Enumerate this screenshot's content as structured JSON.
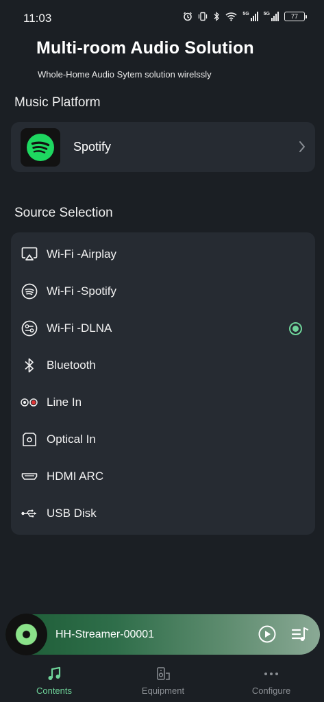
{
  "status_bar": {
    "time": "11:03",
    "signal1_label": "5G",
    "signal2_label": "5G",
    "battery": "77"
  },
  "header": {
    "title": "Multi-room Audio Solution",
    "subtitle": "Whole-Home Audio Sytem solution wirelssly"
  },
  "music_platform": {
    "section_title": "Music Platform",
    "items": [
      {
        "label": "Spotify",
        "icon": "spotify-logo-icon"
      }
    ]
  },
  "source_selection": {
    "section_title": "Source Selection",
    "selected": "Wi-Fi -DLNA",
    "items": [
      {
        "label": "Wi-Fi -Airplay",
        "icon": "airplay-icon"
      },
      {
        "label": "Wi-Fi -Spotify",
        "icon": "spotify-icon"
      },
      {
        "label": "Wi-Fi -DLNA",
        "icon": "dlna-icon"
      },
      {
        "label": "Bluetooth",
        "icon": "bluetooth-icon"
      },
      {
        "label": "Line In",
        "icon": "line-in-icon"
      },
      {
        "label": "Optical In",
        "icon": "optical-icon"
      },
      {
        "label": "HDMI ARC",
        "icon": "hdmi-icon"
      },
      {
        "label": "USB Disk",
        "icon": "usb-icon"
      }
    ]
  },
  "player": {
    "device_name": "HH-Streamer-00001",
    "play_icon": "play-icon",
    "queue_icon": "playlist-icon"
  },
  "bottom_nav": {
    "items": [
      {
        "label": "Contents",
        "icon": "music-note-icon",
        "active": true
      },
      {
        "label": "Equipment",
        "icon": "speaker-icon",
        "active": false
      },
      {
        "label": "Configure",
        "icon": "more-dots-icon",
        "active": false
      }
    ]
  },
  "colors": {
    "background": "#1b1f24",
    "card": "#262b32",
    "accent": "#6fd49a",
    "spotify_green": "#1ed760"
  }
}
